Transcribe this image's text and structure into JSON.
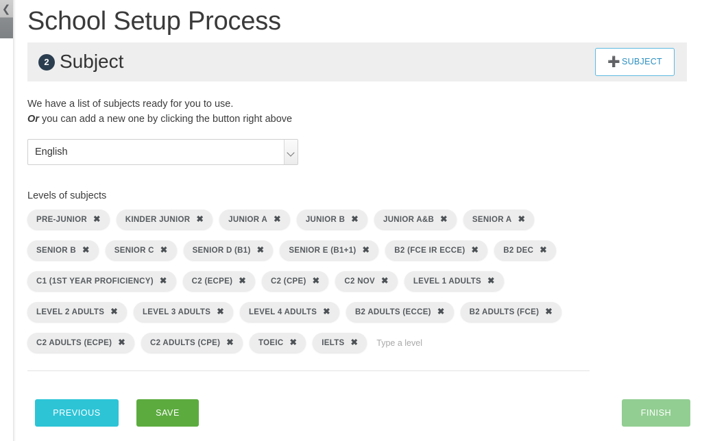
{
  "sidebar": {
    "collapse_icon": "chevron-left-icon"
  },
  "header": {
    "page_title": "School Setup Process",
    "step_number": "2",
    "step_label": "Subject",
    "add_subject_label": "SUBJECT",
    "add_subject_icon": "plus-icon",
    "accent_blue": "#5bb8e0"
  },
  "description": {
    "line1": "We have a list of subjects ready for you to use.",
    "or_word": "Or",
    "line2_rest": " you can add a new one by clicking the button right above"
  },
  "subject_select": {
    "selected": "English",
    "options": [
      "English"
    ],
    "dropdown_icon": "chevron-down-icon"
  },
  "levels": {
    "label": "Levels of subjects",
    "remove_icon": "close-x-icon",
    "input_placeholder": "Type a level",
    "rows": [
      [
        "PRE-JUNIOR",
        "KINDER JUNIOR",
        "JUNIOR A",
        "JUNIOR B",
        "JUNIOR A&B",
        "SENIOR A"
      ],
      [
        "SENIOR B",
        "SENIOR C",
        "SENIOR D (B1)",
        "SENIOR E (B1+1)",
        "B2 (FCE IR ECCE)",
        "B2 DEC"
      ],
      [
        "C1 (1ST YEAR PROFICIENCY)",
        "C2 (ECPE)",
        "C2 (CPE)",
        "C2 NOV",
        "LEVEL 1 ADULTS"
      ],
      [
        "LEVEL 2 ADULTS",
        "LEVEL 3 ADULTS",
        "LEVEL 4 ADULTS",
        "B2 ADULTS (ECCE)",
        "B2 ADULTS (FCE)"
      ],
      [
        "C2 ADULTS (ECPE)",
        "C2 ADULTS (CPE)",
        "TOEIC",
        "IELTS"
      ]
    ]
  },
  "footer": {
    "previous_label": "PREVIOUS",
    "save_label": "SAVE",
    "finish_label": "FINISH",
    "previous_color": "#2dc4d6",
    "save_color": "#5cab3f",
    "finish_color": "#92ce92"
  }
}
